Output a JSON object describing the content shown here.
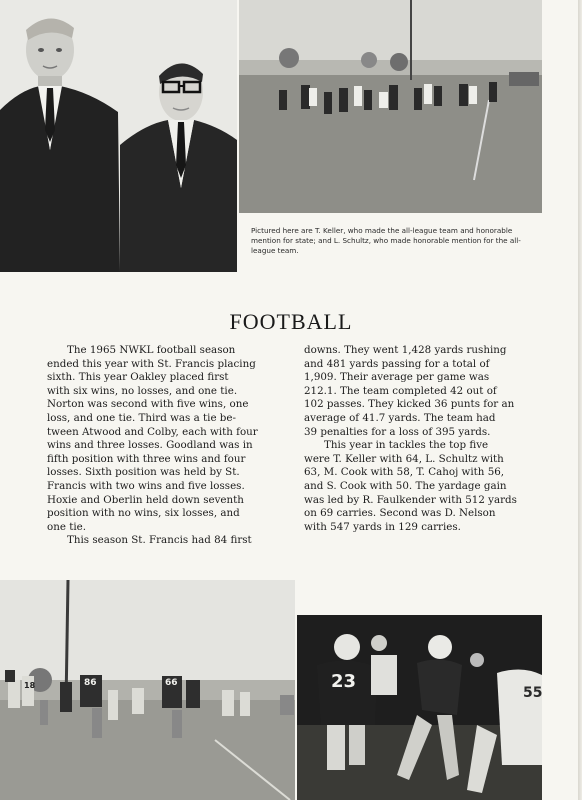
{
  "page": {
    "title": "FOOTBALL",
    "caption": "Pictured here are T. Keller, who made the all-league team and honorable mention for state; and L. Schultz, who made honorable mention for the all-league team.",
    "column_left": {
      "lines": [
        "The 1965 NWKL football season",
        "ended this year with St. Francis placing",
        "sixth. This year Oakley placed first",
        "with six wins, no losses, and one tie.",
        "Norton was second with five wins, one",
        "loss, and one tie. Third was a tie be-",
        "tween Atwood and Colby, each with four",
        "wins and three losses. Goodland was in",
        "fifth position with three wins and four",
        "losses. Sixth position was held by St.",
        "Francis with two wins and five losses.",
        "Hoxie and Oberlin held down seventh",
        "position with no wins, six losses, and",
        "one tie.",
        "This season St. Francis had 84 first"
      ]
    },
    "column_right": {
      "lines": [
        "downs. They went 1,428 yards rushing",
        "and 481 yards passing for a total of",
        "1,909. Their average per game was",
        "212.1. The team completed 42 out of",
        "102 passes. They kicked 36 punts for an",
        "average of 41.7 yards. The team had",
        "39 penalties for a loss of 395 yards.",
        "This year in tackles the top five",
        "were T. Keller with 64, L. Schultz with",
        "63, M. Cook with 58, T. Cahoj with 56,",
        "and S. Cook with 50. The yardage gain",
        "was led by R. Faulkender with 512 yards",
        "on 69 carries. Second was D. Nelson",
        "with 547 yards in 129 carries."
      ]
    },
    "jersey_numbers": {
      "left_photo": [
        "86",
        "66",
        "18"
      ],
      "night_photo": [
        "23",
        "55"
      ]
    }
  }
}
